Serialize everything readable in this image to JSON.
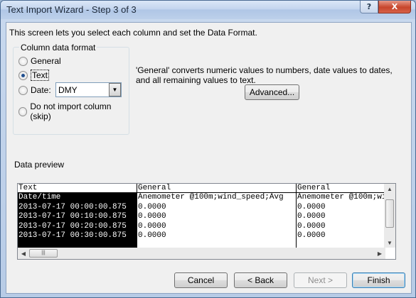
{
  "window": {
    "title": "Text Import Wizard - Step 3 of 3",
    "help_label": "?",
    "close_label": "X"
  },
  "intro_text": "This screen lets you select each column and set the Data Format.",
  "column_format": {
    "legend": "Column data format",
    "options": [
      "General",
      "Text",
      "Date:",
      "Do not import column (skip)"
    ],
    "selected": "Text",
    "date_format": "DMY"
  },
  "description": "'General' converts numeric values to numbers, date values to dates, and all remaining values to text.",
  "advanced_label": "Advanced...",
  "preview": {
    "label": "Data preview",
    "columns": [
      {
        "header": "Text",
        "cells": [
          "Date/time",
          "2013-07-17 00:00:00.875",
          "2013-07-17 00:10:00.875",
          "2013-07-17 00:20:00.875",
          "2013-07-17 00:30:00.875"
        ]
      },
      {
        "header": "General",
        "cells": [
          "Anemometer @100m;wind_speed;Avg",
          "0.0000",
          "0.0000",
          "0.0000",
          "0.0000"
        ]
      },
      {
        "header": "General",
        "cells": [
          "Anemometer @100m;wi",
          "0.0000",
          "0.0000",
          "0.0000",
          "0.0000"
        ]
      }
    ]
  },
  "buttons": {
    "cancel": "Cancel",
    "back": "< Back",
    "next": "Next >",
    "finish": "Finish"
  }
}
